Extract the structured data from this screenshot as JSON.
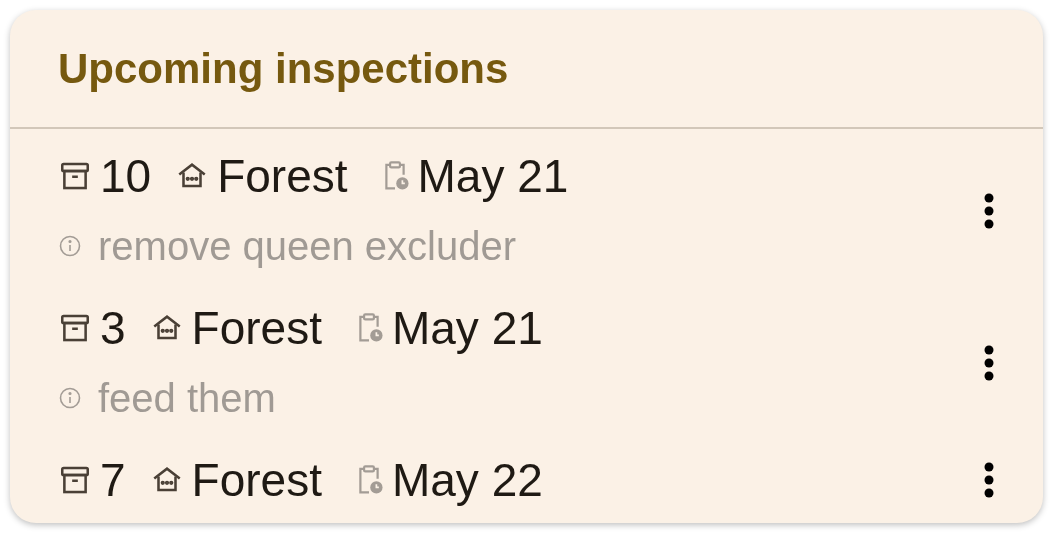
{
  "card": {
    "title": "Upcoming inspections"
  },
  "inspections": [
    {
      "hive": "10",
      "apiary": "Forest",
      "date": "May 21",
      "note": "remove queen excluder"
    },
    {
      "hive": "3",
      "apiary": "Forest",
      "date": "May 21",
      "note": "feed them"
    },
    {
      "hive": "7",
      "apiary": "Forest",
      "date": "May 22"
    }
  ]
}
